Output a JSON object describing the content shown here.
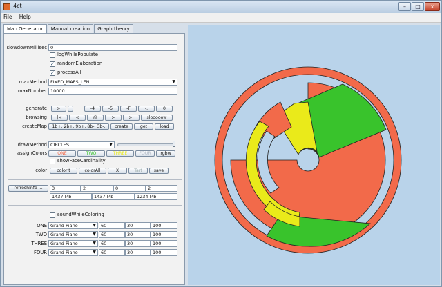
{
  "window": {
    "title": "4ct",
    "controls": {
      "minimize": "–",
      "maximize": "□",
      "close": "x"
    }
  },
  "menu": {
    "file": "File",
    "help": "Help"
  },
  "tabs": [
    {
      "label": "Map Generator",
      "active": true
    },
    {
      "label": "Manual creation"
    },
    {
      "label": "Graph theory"
    }
  ],
  "form": {
    "slowdown_label": "slowdownMillisec",
    "slowdown_value": "0",
    "log_label": "logWhilePopulate",
    "log_checked": false,
    "random_label": "randomElaboration",
    "random_checked": true,
    "process_label": "processAll",
    "process_checked": true,
    "maxmethod_label": "maxMethod",
    "maxmethod_value": "FIXED_MAPS_LEN",
    "maxnumber_label": "maxNumber",
    "maxnumber_value": "10000"
  },
  "generate": {
    "label": "generate",
    "buttons": [
      ">",
      "-4",
      "-5",
      "-F",
      "-.",
      "0"
    ]
  },
  "browsing": {
    "label": "browsing",
    "buttons": [
      "|<",
      "<",
      "@",
      ">",
      ">|",
      "slooooow"
    ]
  },
  "createmap": {
    "label": "createMap",
    "buttons": [
      "1b+. 2b+. 9b+. 8b-. 3b-.",
      "create",
      "get",
      "load"
    ]
  },
  "draw": {
    "drawmethod_label": "drawMethod",
    "drawmethod_value": "CIRCLES",
    "assign_label": "assignColors",
    "assign_buttons": [
      "ONE",
      "TWO",
      "THREE",
      "FOUR",
      "rgbw"
    ],
    "assign_colors": [
      "#f26a4a",
      "#39c32c",
      "#eaea1a",
      "#b0b8c4"
    ],
    "showface_label": "showFaceCardinality",
    "showface_checked": false,
    "color_label": "color",
    "color_buttons": [
      "colorIt",
      "colorAll",
      "X",
      "Tart",
      "save"
    ]
  },
  "info": {
    "refresh_label": "refreshInfo ...",
    "values": [
      "3",
      "2",
      "0",
      "2"
    ],
    "memory": [
      "1437 Mb",
      "1437 Mb",
      "1234 Mb"
    ]
  },
  "sound": {
    "label": "soundWhileColoring",
    "checked": false,
    "rows": [
      {
        "name": "ONE",
        "instrument": "Grand Piano",
        "a": "60",
        "b": "30",
        "c": "100"
      },
      {
        "name": "TWO",
        "instrument": "Grand Piano",
        "a": "60",
        "b": "30",
        "c": "100"
      },
      {
        "name": "THREE",
        "instrument": "Grand Piano",
        "a": "60",
        "b": "30",
        "c": "100"
      },
      {
        "name": "FOUR",
        "instrument": "Grand Piano",
        "a": "60",
        "b": "30",
        "c": "100"
      }
    ]
  },
  "map_colors": {
    "red": "#f26a4a",
    "green": "#39c32c",
    "yellow": "#eaea1a",
    "background": "#b9d3ea"
  }
}
